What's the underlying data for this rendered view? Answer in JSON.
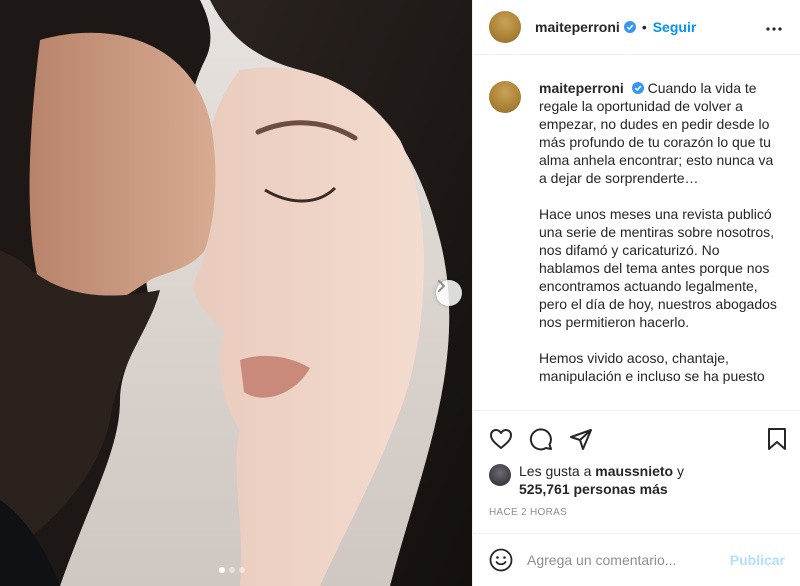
{
  "post": {
    "username": "maiteperroni",
    "verified": true,
    "follow_label": "Seguir",
    "separator": "•",
    "more_icon": "more-horizontal-icon"
  },
  "photo": {
    "description_icon": "photo",
    "next_icon": "chevron-right-icon",
    "carousel": {
      "count": 3,
      "active_index": 0
    }
  },
  "caption": {
    "username": "maiteperroni",
    "paragraphs": [
      "Cuando la vida te regale la oportunidad de volver a empezar, no dudes en pedir desde lo más profundo de tu corazón lo que tu alma anhela encontrar; esto nunca va a dejar de sorprenderte…",
      "Hace unos meses una revista publicó una serie de mentiras sobre nosotros, nos difamó y caricaturizó. No hablamos del tema antes porque nos encontramos actuando legalmente, pero el día de hoy, nuestros abogados nos permitieron hacerlo.",
      "Hemos vivido acoso, chantaje, manipulación e incluso se ha puesto en riesgo nuestra seguridad y la de nuestras familias."
    ]
  },
  "actions": {
    "like_icon": "heart-icon",
    "comment_icon": "comment-icon",
    "share_icon": "paper-plane-icon",
    "save_icon": "bookmark-icon"
  },
  "likes": {
    "prefix": "Les gusta a ",
    "user": "maussnieto",
    "middle": " y",
    "count_text": "525,761 personas más"
  },
  "time_ago": "Hace 2 horas",
  "comment": {
    "placeholder": "Agrega un comentario...",
    "publish_label": "Publicar",
    "emoji_icon": "smiley-icon"
  },
  "colors": {
    "accent": "#0095f6",
    "publish_disabled": "#b2dffc",
    "verified": "#3897f0",
    "muted": "#8e8e8e",
    "border": "#efefef"
  }
}
